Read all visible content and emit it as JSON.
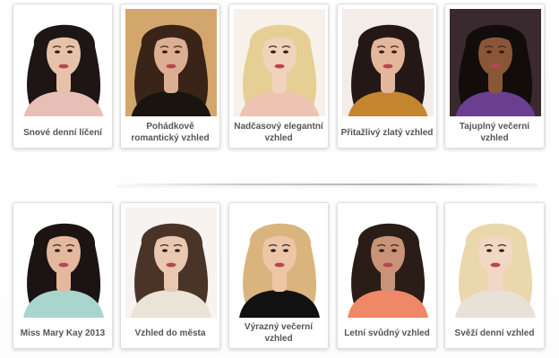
{
  "looks_row_1": [
    {
      "caption": "Snové denní líčení",
      "portrait": "portrait-dark-curly-hair",
      "hair_color": "#1e1614",
      "skin_color": "#e7c2aa",
      "bg_color": "#ffffff",
      "top_color": "#e8bfb6"
    },
    {
      "caption": "Pohádkově romantický vzhled",
      "portrait": "portrait-curly-brunette",
      "hair_color": "#3a2317",
      "skin_color": "#dcaf92",
      "bg_color": "#d3a66d",
      "top_color": "#1a1410"
    },
    {
      "caption": "Nadčasový elegantní vzhled",
      "portrait": "portrait-blonde-curls",
      "hair_color": "#e5cf95",
      "skin_color": "#f1d2bd",
      "bg_color": "#f7f1e9",
      "top_color": "#eec3b3"
    },
    {
      "caption": "Přitažlivý zlatý vzhled",
      "portrait": "portrait-dark-long-hair-gold",
      "hair_color": "#241816",
      "skin_color": "#e4b69c",
      "bg_color": "#f3ece9",
      "top_color": "#c3862e"
    },
    {
      "caption": "Tajuplný večerní vzhled",
      "portrait": "portrait-dark-skin-purple",
      "hair_color": "#120d0b",
      "skin_color": "#8a5638",
      "bg_color": "#3a2a30",
      "top_color": "#6a3f92"
    }
  ],
  "looks_row_2": [
    {
      "caption": "Miss Mary Kay 2013",
      "portrait": "portrait-ponytail-smile",
      "hair_color": "#1b1412",
      "skin_color": "#e3b89d",
      "bg_color": "#ffffff",
      "top_color": "#a8d6cf"
    },
    {
      "caption": "Vzhled do města",
      "portrait": "portrait-long-straight-brunette",
      "hair_color": "#4a3428",
      "skin_color": "#e9c7b1",
      "bg_color": "#f6f3f0",
      "top_color": "#e9e3d8"
    },
    {
      "caption": "Výrazný večerní vzhled",
      "portrait": "portrait-blonde-flowing",
      "hair_color": "#d9b57d",
      "skin_color": "#edc6a8",
      "bg_color": "#ffffff",
      "top_color": "#111111"
    },
    {
      "caption": "Letní svůdný vzhled",
      "portrait": "portrait-dark-waves-coral",
      "hair_color": "#2a1c17",
      "skin_color": "#c99377",
      "bg_color": "#ffffff",
      "top_color": "#ee8866"
    },
    {
      "caption": "Svěží denní vzhled",
      "portrait": "portrait-platinum-blonde",
      "hair_color": "#ead7ab",
      "skin_color": "#f1d8c4",
      "bg_color": "#ffffff",
      "top_color": "#e7e1d8"
    }
  ]
}
